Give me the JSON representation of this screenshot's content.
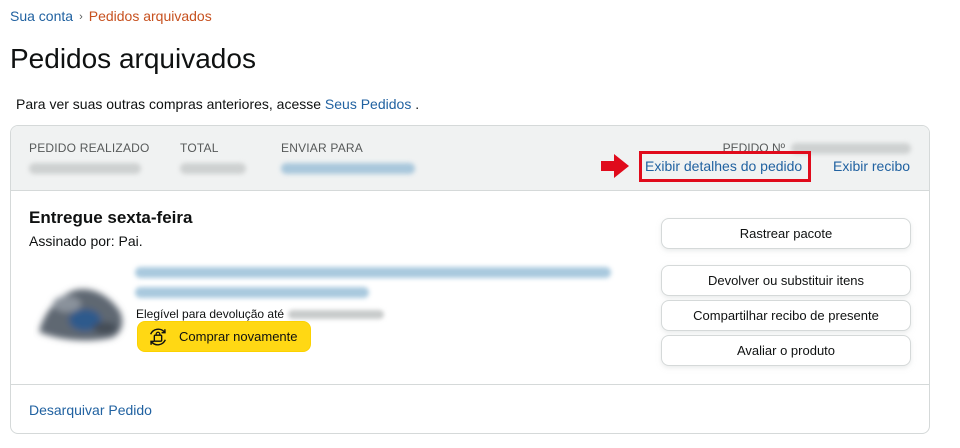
{
  "breadcrumb": {
    "parent": "Sua conta",
    "separator": "›",
    "current": "Pedidos arquivados"
  },
  "page": {
    "title": "Pedidos arquivados",
    "intro_text": "Para ver suas outras compras anteriores, acesse ",
    "intro_link": "Seus Pedidos",
    "intro_end": " ."
  },
  "order": {
    "header": {
      "placed_label": "PEDIDO REALIZADO",
      "total_label": "TOTAL",
      "ship_to_label": "ENVIAR PARA",
      "order_number_label": "PEDIDO Nº",
      "details_link": "Exibir detalhes do pedido",
      "receipt_link": "Exibir recibo"
    },
    "status": "Entregue sexta-feira",
    "signed_by": "Assinado por: Pai.",
    "return_eligibility": "Elegível para devolução até",
    "buy_again_label": "Comprar novamente",
    "actions": {
      "track": "Rastrear pacote",
      "return": "Devolver ou substituir itens",
      "gift_receipt": "Compartilhar recibo de presente",
      "review": "Avaliar o produto"
    },
    "unarchive_link": "Desarquivar Pedido"
  },
  "colors": {
    "link": "#2162a1",
    "breadcrumb_current": "#c7511f",
    "header_bg": "#f0f2f2",
    "buy_again_bg": "#ffd814",
    "highlight_red": "#e00b1c"
  },
  "icons": {
    "breadcrumb_separator": "chevron-right-icon",
    "annotation_arrow": "red-arrow-icon",
    "buy_again": "rebuy-bag-icon"
  }
}
